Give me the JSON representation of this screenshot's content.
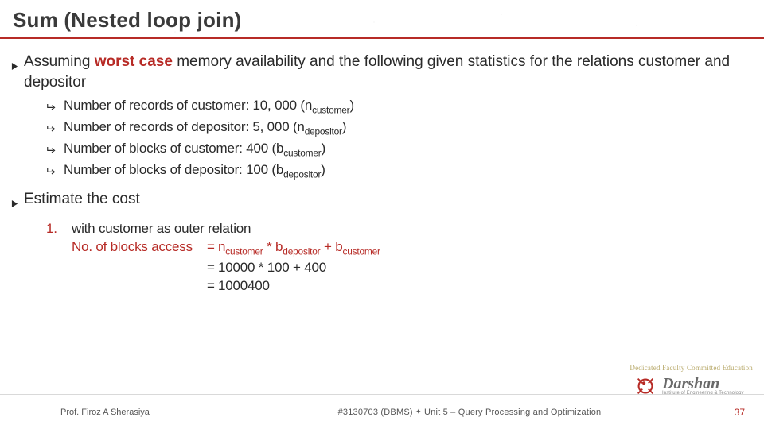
{
  "title": "Sum (Nested loop join)",
  "b1_pre": "Assuming ",
  "b1_wc": "worst case",
  "b1_post": " memory availability and the following given statistics for the relations customer and depositor",
  "s1_pre": "Number of records of customer: 10, 000 (n",
  "s1_sub": "customer",
  "s1_post": ")",
  "s2_pre": "Number of records of depositor: 5, 000 (n",
  "s2_sub": "depositor",
  "s2_post": ")",
  "s3_pre": "Number of blocks of customer: 400 (b",
  "s3_sub": "customer",
  "s3_post": ")",
  "s4_pre": "Number of blocks of depositor: 100 (b",
  "s4_sub": "depositor",
  "s4_post": ")",
  "b2": "Estimate the cost",
  "ol_num": "1.",
  "ol_line1": "with customer as outer relation",
  "calc_label": "No. of blocks access",
  "calc_eq": "=",
  "c1_a": " n",
  "c1_a_sub": "customer",
  "c1_b": " * b",
  "c1_b_sub": "depositor",
  "c1_c": " + b",
  "c1_c_sub": "customer",
  "c2": " 10000 * 100 + 400",
  "c3": " 1000400",
  "footer_author": "Prof. Firoz A Sherasiya",
  "footer_center_a": "#3130703 (DBMS) ",
  "footer_center_b": " Unit 5 – Query Processing and Optimization",
  "footer_page": "37",
  "logo_text": "Darshan",
  "logo_sub": "Institute of Engineering & Technology",
  "logo_tag": "Dedicated Faculty Committed Education"
}
